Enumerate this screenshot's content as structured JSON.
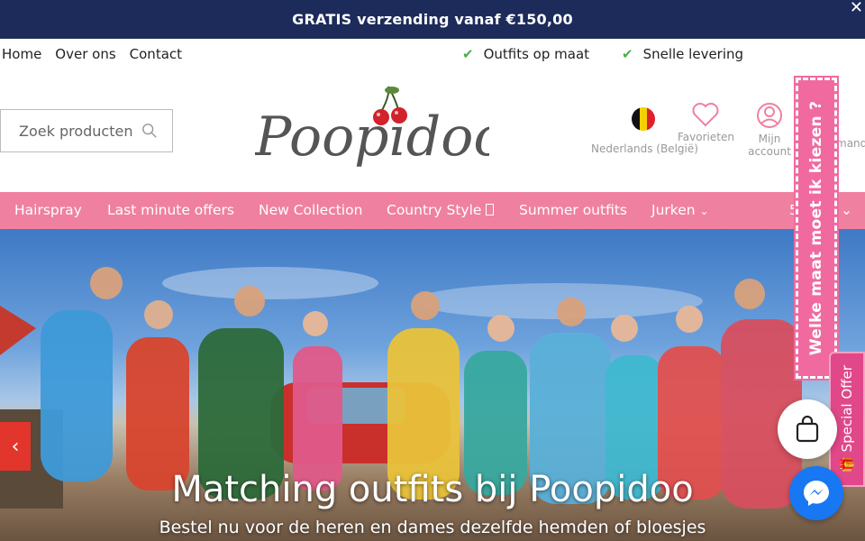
{
  "announcement": {
    "text": "GRATIS verzending vanaf €150,00",
    "close": "✕"
  },
  "subnav": {
    "links": [
      "Home",
      "Over ons",
      "Contact"
    ],
    "usps": [
      "Outfits op maat",
      "Snelle levering"
    ]
  },
  "header": {
    "search_placeholder": "Zoek producten",
    "logo_text": "Poopidoo",
    "language": "Nederlands (België)",
    "favorites": "Favorieten",
    "account_line1": "Mijn",
    "account_line2": "account",
    "cart_partial": "mand"
  },
  "menu": {
    "items": [
      "Hairspray",
      "Last minute offers",
      "New Collection",
      "Country Style ",
      "Summer outfits",
      "Jurken"
    ],
    "partial_right": "5"
  },
  "hero": {
    "title": "Matching outfits bij Poopidoo",
    "subtitle": "Bestel nu voor de heren en dames dezelfde hemden of bloesjes"
  },
  "side_tabs": {
    "size_help": "Welke maat moet ik kiezen ?",
    "special_offer": "Special Offer"
  },
  "colors": {
    "announcement_bg": "#1c2b5a",
    "menu_bg": "#f080a0",
    "accent_pink": "#f06aa0",
    "check_green": "#4cae4c",
    "messenger_blue": "#1877f2"
  }
}
